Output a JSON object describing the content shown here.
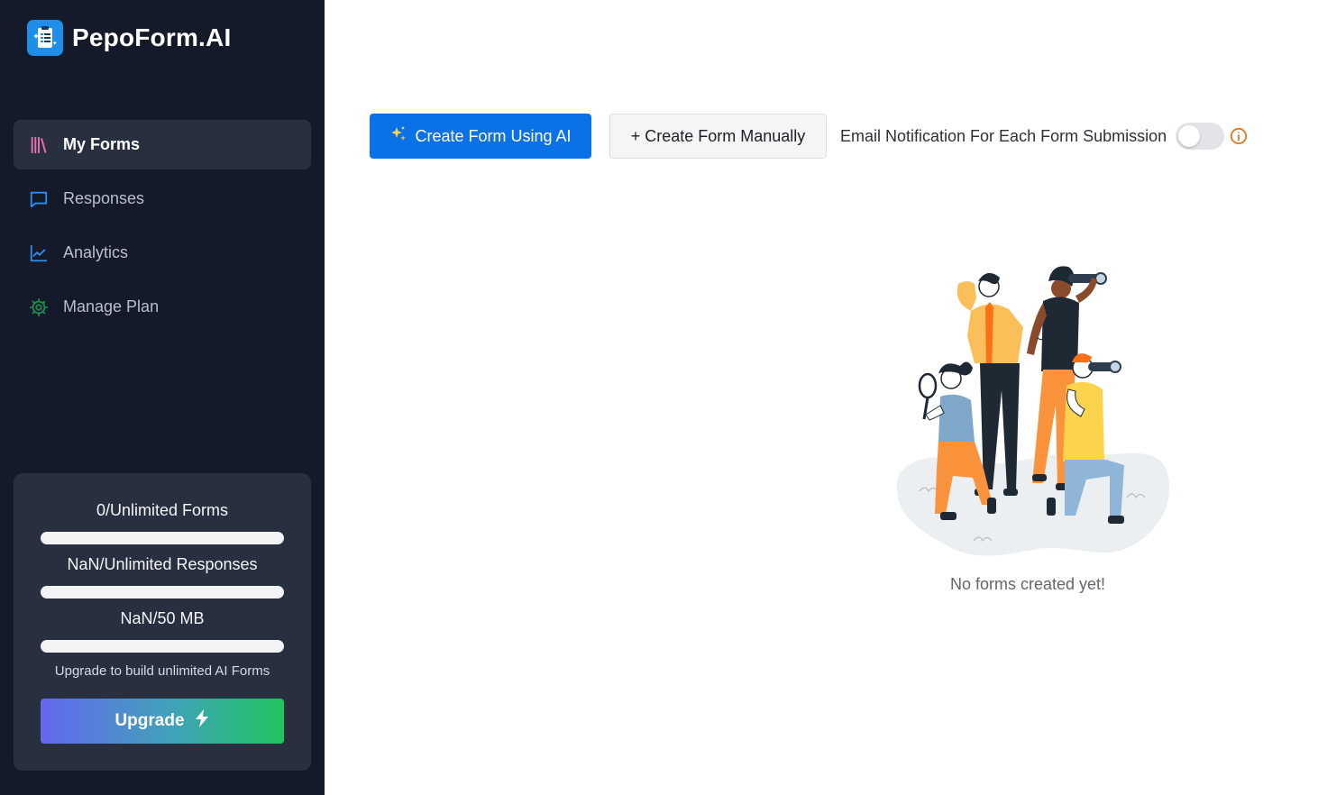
{
  "brand": {
    "name": "PepoForm.AI",
    "logo_icon": "form-clipboard-icon"
  },
  "sidebar": {
    "items": [
      {
        "label": "My Forms",
        "icon": "library-books-icon",
        "active": true,
        "icon_color": "#f472b6"
      },
      {
        "label": "Responses",
        "icon": "chat-bubble-icon",
        "active": false,
        "icon_color": "#2e8ef0"
      },
      {
        "label": "Analytics",
        "icon": "line-chart-icon",
        "active": false,
        "icon_color": "#2e8ef0"
      },
      {
        "label": "Manage Plan",
        "icon": "gear-icon",
        "active": false,
        "icon_color": "#1e8a4a"
      }
    ]
  },
  "usage": {
    "forms_label": "0/Unlimited Forms",
    "forms_fraction": 0,
    "responses_label": "NaN/Unlimited Responses",
    "responses_fraction": 0,
    "storage_label": "NaN/50 MB",
    "storage_fraction": 0,
    "note": "Upgrade to build unlimited AI Forms",
    "upgrade_label": "Upgrade",
    "upgrade_icon": "lightning-bolt-icon"
  },
  "toolbar": {
    "create_ai_label": "Create Form Using AI",
    "create_ai_icon": "sparkles-icon",
    "create_manual_label": "+ Create Form Manually",
    "email_notification_label": "Email Notification For Each Form Submission",
    "email_notification_enabled": false,
    "info_icon": "info-circle-icon"
  },
  "empty_state": {
    "message": "No forms created yet!",
    "illustration": "people-searching-illustration"
  },
  "colors": {
    "sidebar_bg": "#141a2a",
    "sidebar_active_bg": "#283040",
    "primary": "#0a72e6",
    "info_orange": "#e8751a"
  }
}
